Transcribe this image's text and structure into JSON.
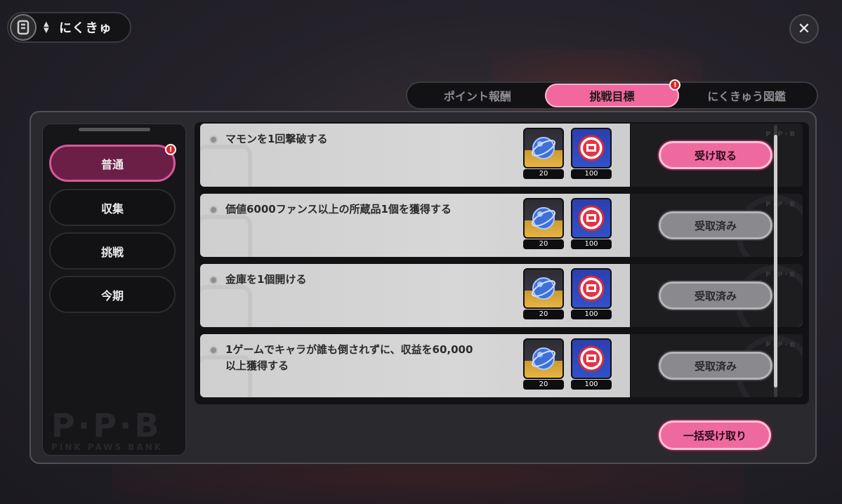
{
  "header": {
    "player_name": "にくきゅ",
    "close_icon": "close-icon"
  },
  "tabs": [
    {
      "label": "ポイント報酬",
      "active": false,
      "alert": false
    },
    {
      "label": "挑戦目標",
      "active": true,
      "alert": true
    },
    {
      "label": "にくきゅう図鑑",
      "active": false,
      "alert": false
    }
  ],
  "sidebar": {
    "items": [
      {
        "label": "普通",
        "active": true,
        "alert": true
      },
      {
        "label": "収集",
        "active": false,
        "alert": false
      },
      {
        "label": "挑戦",
        "active": false,
        "alert": false
      },
      {
        "label": "今期",
        "active": false,
        "alert": false
      }
    ],
    "watermark_main": "P·P·B",
    "watermark_sub": "PINK PAWS BANK"
  },
  "alert_mark": "!",
  "tasks": [
    {
      "label": "マモンを1回撃破する",
      "rewards": [
        {
          "icon": "blue-orb-icon",
          "count": "20"
        },
        {
          "icon": "ppb-coin-icon",
          "count": "100"
        }
      ],
      "button": "受け取る",
      "state": "claimable"
    },
    {
      "label": "価値6000ファンス以上の所蔵品1個を獲得する",
      "rewards": [
        {
          "icon": "blue-orb-icon",
          "count": "20"
        },
        {
          "icon": "ppb-coin-icon",
          "count": "100"
        }
      ],
      "button": "受取済み",
      "state": "claimed"
    },
    {
      "label": "金庫を1個開ける",
      "rewards": [
        {
          "icon": "blue-orb-icon",
          "count": "20"
        },
        {
          "icon": "ppb-coin-icon",
          "count": "100"
        }
      ],
      "button": "受取済み",
      "state": "claimed"
    },
    {
      "label": "1ゲームでキャラが誰も倒されずに、収益を60,000以上獲得する",
      "rewards": [
        {
          "icon": "blue-orb-icon",
          "count": "20"
        },
        {
          "icon": "ppb-coin-icon",
          "count": "100"
        }
      ],
      "button": "受取済み",
      "state": "claimed"
    }
  ],
  "bulk_claim_label": "一括受け取り",
  "colors": {
    "accent_pink": "#ee6a9e",
    "sidebar_active": "#6b1f47",
    "alert_red": "#d8262e",
    "claimed_gray": "#8a8a8e"
  }
}
